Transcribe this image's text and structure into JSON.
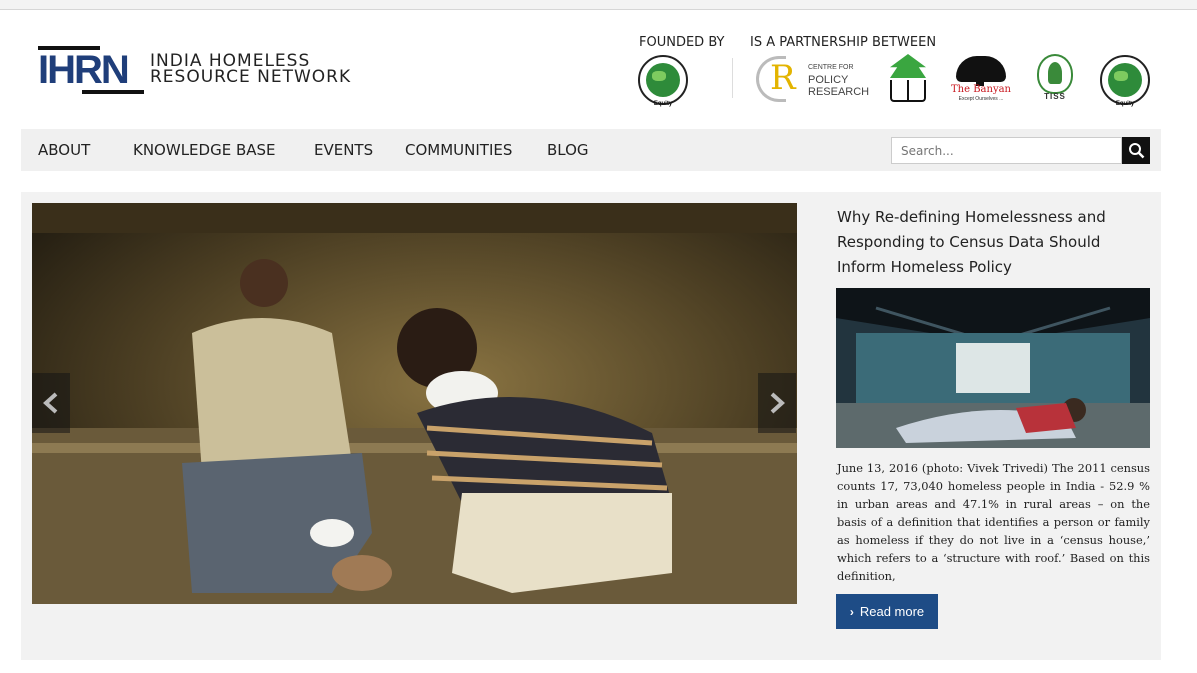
{
  "logo": {
    "mark": "IHRN",
    "line1": "INDIA HOMELESS",
    "line2": "RESOURCE NETWORK"
  },
  "partners": {
    "founded_label": "FOUNDED BY",
    "partnership_label": "IS A PARTNERSHIP BETWEEN",
    "emblem_text": "Equity",
    "cpr_small": "CENTRE FOR",
    "cpr_line1": "POLICY",
    "cpr_line2": "RESEARCH",
    "banyan_name": "The Banyan",
    "tiss_label": "TISS"
  },
  "nav": {
    "items": [
      {
        "label": "ABOUT"
      },
      {
        "label": "KNOWLEDGE BASE"
      },
      {
        "label": "EVENTS"
      },
      {
        "label": "COMMUNITIES"
      },
      {
        "label": "BLOG"
      }
    ],
    "search_placeholder": "Search..."
  },
  "article": {
    "title": "Why Re-defining Homelessness and Responding to Census Data Should Inform Homeless Policy",
    "excerpt": "June 13, 2016 (photo: Vivek Trivedi) The 2011 census counts 17, 73,040 homeless people in India - 52.9 % in urban areas and 47.1% in rural areas – on the basis of a definition that identifies a person or family as homeless if they do not live in a ‘census house,’ which refers to a ‘structure with roof.’ Based on this definition,",
    "read_more": "Read more"
  },
  "colors": {
    "brand_blue": "#1f3e7a",
    "button_blue": "#1e4c86",
    "nav_bg": "#f0f0f0"
  }
}
